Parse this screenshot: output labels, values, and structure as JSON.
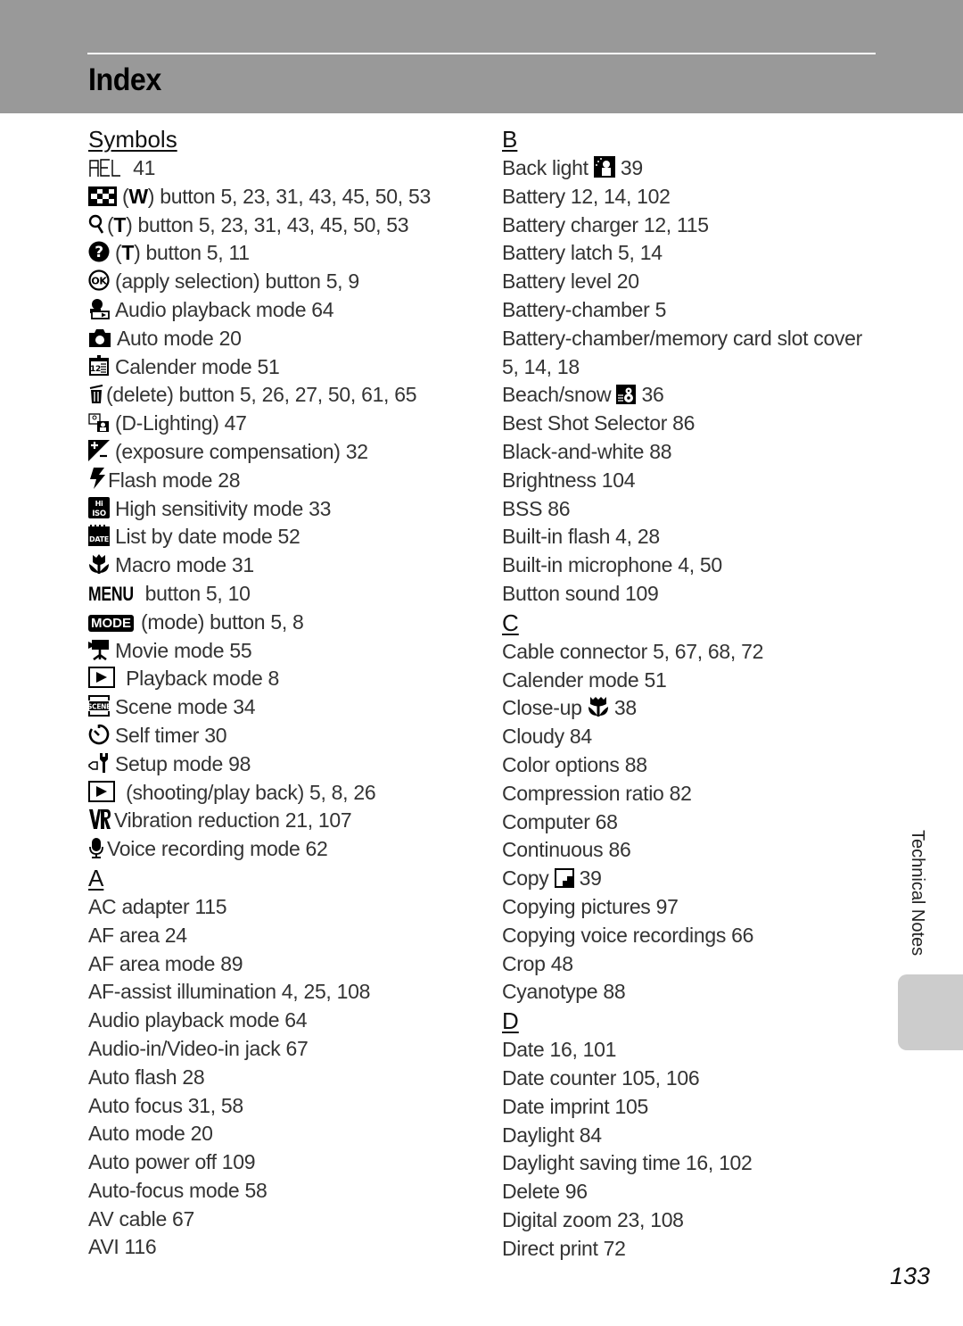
{
  "header": {
    "title": "Index"
  },
  "side_tab": {
    "label": "Technical Notes"
  },
  "page_number": "133",
  "left_column": {
    "symbols_heading": "Symbols",
    "symbols": [
      {
        "icon": "ael-icon",
        "glyph": "AEL",
        "text": " 41"
      },
      {
        "icon": "wide-thumbnail-icon",
        "glyph": "▦",
        "key": "W",
        "text": " button 5, 23, 31, 43, 45, 50, 53"
      },
      {
        "icon": "zoom-magnifier-icon",
        "glyph": "⚲",
        "key": "T",
        "text": " button 5, 23, 31, 43, 45, 50, 53"
      },
      {
        "icon": "help-icon",
        "glyph": "?",
        "key": "T",
        "text": " button 5, 11"
      },
      {
        "icon": "ok-icon",
        "glyph": "OK",
        "text": "(apply selection) button 5, 9"
      },
      {
        "icon": "audio-playback-icon",
        "glyph": "♫",
        "text": "Audio playback mode 64"
      },
      {
        "icon": "camera-icon",
        "glyph": "◘",
        "text": "Auto mode 20"
      },
      {
        "icon": "calendar-icon",
        "glyph": "12",
        "text": "Calender mode 51"
      },
      {
        "icon": "trash-icon",
        "glyph": "🗑",
        "text": "(delete) button 5, 26, 27, 50, 61, 65"
      },
      {
        "icon": "d-lighting-icon",
        "glyph": "▣",
        "text": "(D-Lighting) 47"
      },
      {
        "icon": "exposure-compensation-icon",
        "glyph": "±",
        "text": "(exposure compensation) 32"
      },
      {
        "icon": "flash-icon",
        "glyph": "⚡",
        "text": "Flash mode 28"
      },
      {
        "icon": "hi-iso-icon",
        "glyph": "HI",
        "text": "High sensitivity mode 33"
      },
      {
        "icon": "date-list-icon",
        "glyph": "DATE",
        "text": "List by date mode 52"
      },
      {
        "icon": "macro-flower-icon",
        "glyph": "✿",
        "text": "Macro mode 31"
      },
      {
        "icon": "menu-icon",
        "glyph": "MENU",
        "text": " button 5, 10"
      },
      {
        "icon": "mode-icon",
        "glyph": "MODE",
        "text": "(mode) button 5, 8"
      },
      {
        "icon": "movie-camera-icon",
        "glyph": "🎥",
        "text": "Movie mode 55"
      },
      {
        "icon": "playback-icon",
        "glyph": "▶",
        "text": " Playback mode 8"
      },
      {
        "icon": "scene-icon",
        "glyph": "SCENE",
        "text": "Scene mode 34"
      },
      {
        "icon": "self-timer-icon",
        "glyph": "⏱",
        "text": "Self timer 30"
      },
      {
        "icon": "setup-wrench-icon",
        "glyph": "🔧",
        "text": "Setup mode 98"
      },
      {
        "icon": "shooting-playback-icon",
        "glyph": "▶",
        "text": " (shooting/play back) 5, 8, 26"
      },
      {
        "icon": "vr-icon",
        "glyph": "VR",
        "text": "Vibration reduction 21, 107"
      },
      {
        "icon": "microphone-icon",
        "glyph": "🎙",
        "text": "Voice recording mode 62"
      }
    ],
    "a_heading": "A",
    "a_entries": [
      "AC adapter 115",
      "AF area 24",
      "AF area mode 89",
      "AF-assist illumination 4, 25, 108",
      "Audio playback mode 64",
      "Audio-in/Video-in jack 67",
      "Auto flash 28",
      "Auto focus 31, 58",
      "Auto mode 20",
      "Auto power off 109",
      "Auto-focus mode 58",
      "AV cable 67",
      "AVI 116"
    ]
  },
  "right_column": {
    "b_heading": "B",
    "b_entries": [
      {
        "text": "Back light ",
        "icon": "backlight-icon",
        "after": " 39"
      },
      {
        "text": "Battery 12, 14, 102"
      },
      {
        "text": "Battery charger 12, 115"
      },
      {
        "text": "Battery latch 5, 14"
      },
      {
        "text": "Battery level 20"
      },
      {
        "text": "Battery-chamber 5"
      },
      {
        "text": "Battery-chamber/memory card slot cover"
      },
      {
        "text": "5, 14, 18"
      },
      {
        "text": "Beach/snow ",
        "icon": "beach-snow-icon",
        "after": " 36"
      },
      {
        "text": "Best Shot Selector 86"
      },
      {
        "text": "Black-and-white 88"
      },
      {
        "text": "Brightness 104"
      },
      {
        "text": "BSS 86"
      },
      {
        "text": "Built-in flash 4, 28"
      },
      {
        "text": "Built-in microphone 4, 50"
      },
      {
        "text": "Button sound 109"
      }
    ],
    "c_heading": "C",
    "c_entries": [
      {
        "text": "Cable connector 5, 67, 68, 72"
      },
      {
        "text": "Calender mode 51"
      },
      {
        "text": "Close-up ",
        "icon": "close-up-icon",
        "after": " 38"
      },
      {
        "text": "Cloudy 84"
      },
      {
        "text": "Color options 88"
      },
      {
        "text": "Compression ratio 82"
      },
      {
        "text": "Computer 68"
      },
      {
        "text": "Continuous 86"
      },
      {
        "text": "Copy ",
        "icon": "copy-icon",
        "after": " 39"
      },
      {
        "text": "Copying pictures 97"
      },
      {
        "text": "Copying voice recordings 66"
      },
      {
        "text": "Crop 48"
      },
      {
        "text": "Cyanotype 88"
      }
    ],
    "d_heading": "D",
    "d_entries": [
      "Date 16, 101",
      "Date counter 105, 106",
      "Date imprint 105",
      "Daylight 84",
      "Daylight saving time 16, 102",
      "Delete 96",
      "Digital zoom 23, 108",
      "Direct print 72"
    ]
  }
}
